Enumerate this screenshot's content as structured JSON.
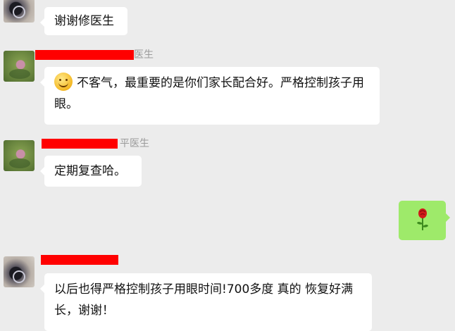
{
  "messages": [
    {
      "text": "谢谢修医生"
    },
    {
      "name_suffix": "医生",
      "emoji": "smile-emoji",
      "text": "不客气，最重要的是你们家长配合好。严格控制孩子用眼。"
    },
    {
      "name_suffix": "平医生",
      "text": "定期复查哈。"
    },
    {
      "emoji": "rose-emoji"
    },
    {
      "text": "以后也得严格控制孩子用眼时间!700多度 真的 恢复好满长，谢谢！"
    }
  ]
}
